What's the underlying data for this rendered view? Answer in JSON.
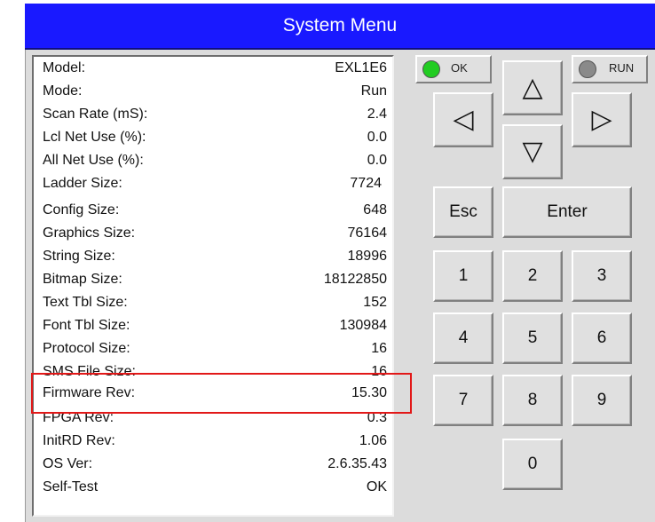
{
  "title": "System Menu",
  "info": [
    {
      "label": "Model:",
      "value": "EXL1E6"
    },
    {
      "label": "Mode:",
      "value": "Run"
    },
    {
      "label": "Scan Rate (mS):",
      "value": "2.4"
    },
    {
      "label": "Lcl Net Use (%):",
      "value": "0.0"
    },
    {
      "label": "All Net Use (%):",
      "value": "0.0"
    },
    {
      "label": "Ladder Size:",
      "value": "7724"
    },
    {
      "label": "Config Size:",
      "value": "648"
    },
    {
      "label": "Graphics Size:",
      "value": "76164"
    },
    {
      "label": "String Size:",
      "value": "18996"
    },
    {
      "label": "Bitmap Size:",
      "value": "18122850"
    },
    {
      "label": "Text Tbl Size:",
      "value": "152"
    },
    {
      "label": "Font Tbl Size:",
      "value": "130984"
    },
    {
      "label": "Protocol Size:",
      "value": "16"
    },
    {
      "label": "SMS File Size:",
      "value": "16"
    },
    {
      "label": "Firmware Rev:",
      "value": "15.30"
    },
    {
      "label": "FPGA Rev:",
      "value": "0.3"
    },
    {
      "label": "InitRD Rev:",
      "value": "1.06"
    },
    {
      "label": "OS Ver:",
      "value": "2.6.35.43"
    },
    {
      "label": "Self-Test",
      "value": "OK"
    }
  ],
  "status": {
    "ok_label": "OK",
    "ok_color": "#22cc22",
    "run_label": "RUN",
    "run_color": "#8a8a8a"
  },
  "keys": {
    "up_icon": "up-triangle-icon",
    "down_icon": "down-triangle-icon",
    "left_icon": "left-triangle-icon",
    "right_icon": "right-triangle-icon",
    "up_glyph": "△",
    "down_glyph": "▽",
    "left_glyph": "◁",
    "right_glyph": "▷",
    "esc": "Esc",
    "enter": "Enter",
    "digits": [
      "1",
      "2",
      "3",
      "4",
      "5",
      "6",
      "7",
      "8",
      "9",
      "0"
    ]
  },
  "colors": {
    "titlebar": "#1919ff",
    "highlight": "#e21818"
  }
}
